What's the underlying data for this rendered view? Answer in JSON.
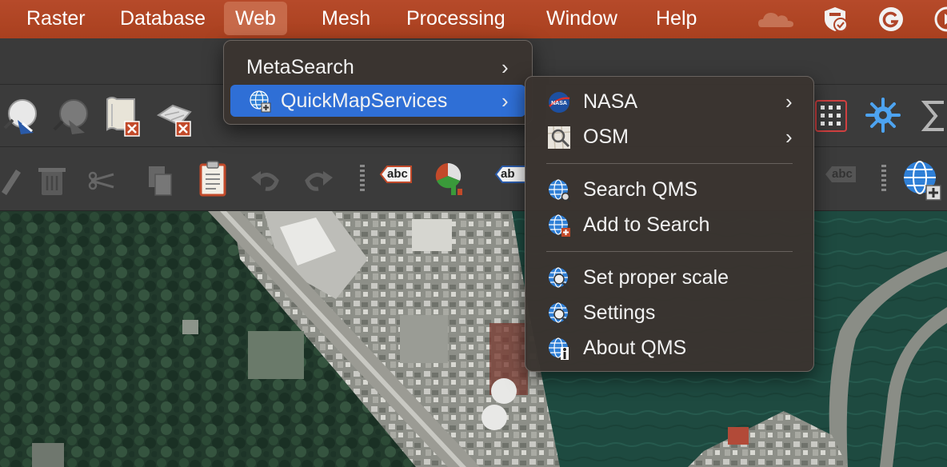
{
  "menubar": {
    "items": [
      "Raster",
      "Database",
      "Web",
      "Mesh",
      "Processing",
      "Window",
      "Help"
    ],
    "active": "Web"
  },
  "web_menu": {
    "items": [
      {
        "label": "MetaSearch",
        "submenu": true
      },
      {
        "label": "QuickMapServices",
        "submenu": true,
        "highlighted": true,
        "icon": "qms-globe-icon"
      }
    ]
  },
  "qms_menu": {
    "groups": [
      [
        {
          "label": "NASA",
          "submenu": true,
          "icon": "nasa-logo-icon"
        },
        {
          "label": "OSM",
          "submenu": true,
          "icon": "osm-icon"
        }
      ],
      [
        {
          "label": "Search QMS",
          "icon": "globe-search-icon"
        },
        {
          "label": "Add to Search",
          "icon": "globe-add-icon"
        }
      ],
      [
        {
          "label": "Set proper scale",
          "icon": "globe-scale-icon"
        },
        {
          "label": "Settings",
          "icon": "globe-settings-icon"
        },
        {
          "label": "About QMS",
          "icon": "globe-info-icon"
        }
      ]
    ]
  },
  "toolbar_labels": {
    "label_tool_1": "abc",
    "label_tool_2": "ab",
    "label_tool_3": "abc"
  },
  "colors": {
    "menubar": "#b0452a",
    "highlight": "#2f6fd6",
    "menu_bg": "#3a3430",
    "toolbar_bg": "#3b3b3b"
  }
}
